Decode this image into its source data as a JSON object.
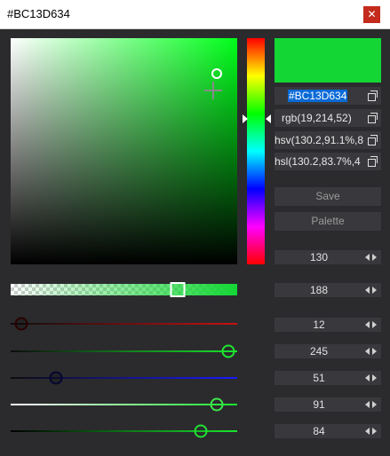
{
  "window": {
    "title": "#BC13D634",
    "close_icon": "close-icon"
  },
  "color": {
    "hue": 130.2,
    "saturation_v": 91.1,
    "value": 83.9,
    "r": 19,
    "g": 214,
    "b": 52,
    "a": 188,
    "preview": "#13d634"
  },
  "fields": {
    "hex": "#BC13D634",
    "rgb": "rgb(19,214,52)",
    "hsv": "hsv(130.2,91.1%,8",
    "hsl": "hsl(130.2,83.7%,4"
  },
  "buttons": {
    "save": "Save",
    "palette": "Palette"
  },
  "spinners": {
    "hue": "130",
    "alpha": "188",
    "red": "12",
    "green": "245",
    "blue": "51",
    "saturation": "91",
    "value": "84"
  },
  "sliders": {
    "alpha": 0.737,
    "red": 0.047,
    "green": 0.961,
    "blue": 0.2,
    "saturation": 0.91,
    "value": 0.839
  }
}
